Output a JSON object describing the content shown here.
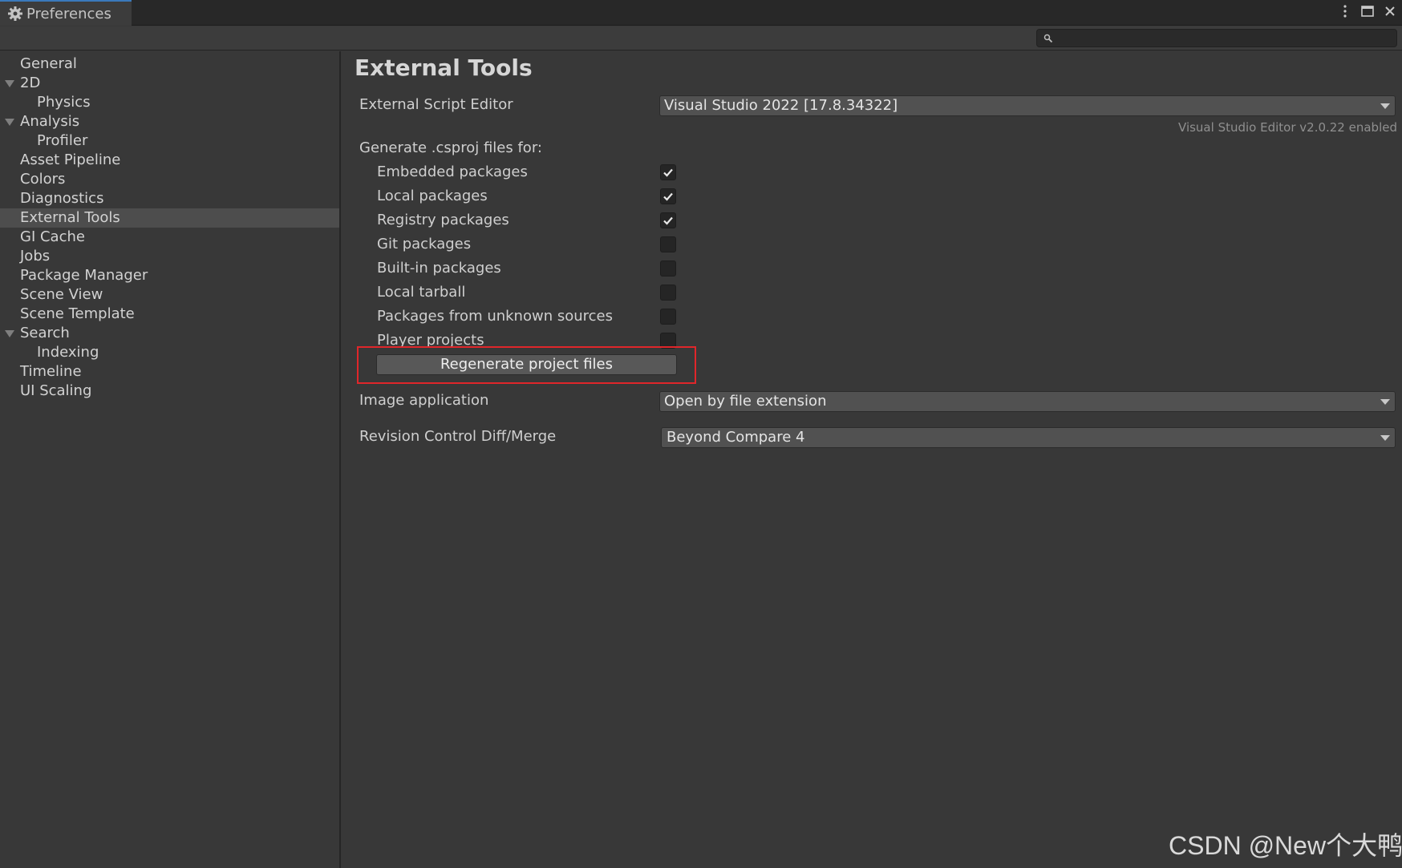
{
  "window": {
    "tab_title": "Preferences"
  },
  "search": {
    "placeholder": ""
  },
  "sidebar": {
    "items": [
      {
        "label": "General"
      },
      {
        "label": "2D"
      },
      {
        "label": "Physics"
      },
      {
        "label": "Analysis"
      },
      {
        "label": "Profiler"
      },
      {
        "label": "Asset Pipeline"
      },
      {
        "label": "Colors"
      },
      {
        "label": "Diagnostics"
      },
      {
        "label": "External Tools",
        "selected": true
      },
      {
        "label": "GI Cache"
      },
      {
        "label": "Jobs"
      },
      {
        "label": "Package Manager"
      },
      {
        "label": "Scene View"
      },
      {
        "label": "Scene Template"
      },
      {
        "label": "Search"
      },
      {
        "label": "Indexing"
      },
      {
        "label": "Timeline"
      },
      {
        "label": "UI Scaling"
      }
    ]
  },
  "main": {
    "title": "External Tools",
    "script_editor_label": "External Script Editor",
    "script_editor_value": "Visual Studio 2022 [17.8.34322]",
    "vs_editor_note": "Visual Studio Editor v2.0.22 enabled",
    "generate_label": "Generate .csproj files for:",
    "csproj_options": [
      {
        "label": "Embedded packages",
        "checked": true
      },
      {
        "label": "Local packages",
        "checked": true
      },
      {
        "label": "Registry packages",
        "checked": true
      },
      {
        "label": "Git packages",
        "checked": false
      },
      {
        "label": "Built-in packages",
        "checked": false
      },
      {
        "label": "Local tarball",
        "checked": false
      },
      {
        "label": "Packages from unknown sources",
        "checked": false
      },
      {
        "label": "Player projects",
        "checked": false
      }
    ],
    "regenerate_button": "Regenerate project files",
    "image_app_label": "Image application",
    "image_app_value": "Open by file extension",
    "diff_label": "Revision Control Diff/Merge",
    "diff_value": "Beyond Compare 4"
  },
  "watermark": "CSDN @New个大鸭",
  "colors": {
    "highlight_border": "#e0262a",
    "tab_accent": "#3a79bb",
    "selected_row": "#4d4d4d"
  }
}
